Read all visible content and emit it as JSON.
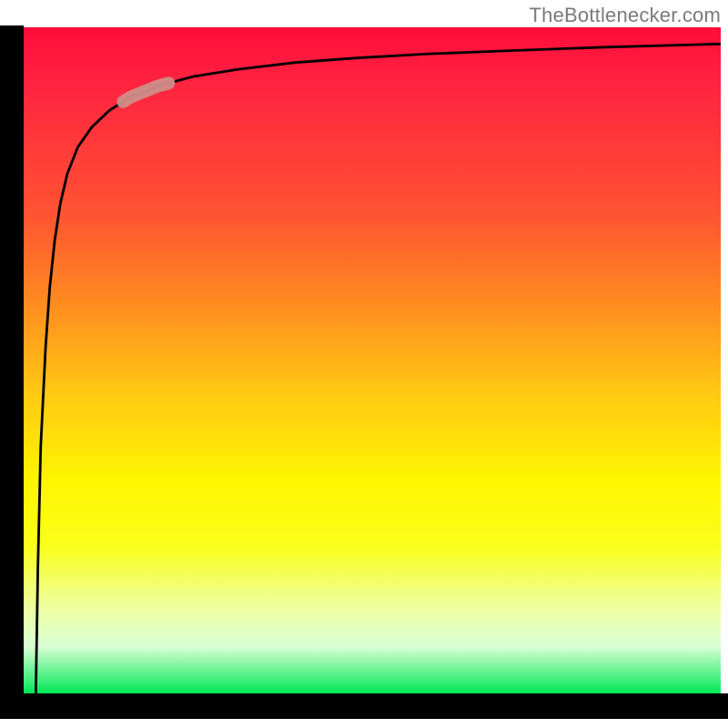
{
  "watermark": "TheBottlenecker.com",
  "chart_data": {
    "type": "line",
    "title": "",
    "xlabel": "",
    "ylabel": "",
    "xlim": [
      0,
      1
    ],
    "ylim": [
      0,
      1
    ],
    "grid": false,
    "background_gradient": [
      "#ff0c3a",
      "#ff8e1f",
      "#fff500",
      "#00e756"
    ],
    "series": [
      {
        "name": "curve",
        "x": [
          0.02,
          0.023,
          0.027,
          0.034,
          0.04,
          0.047,
          0.055,
          0.065,
          0.08,
          0.1,
          0.125,
          0.155,
          0.195,
          0.245,
          0.31,
          0.39,
          0.48,
          0.58,
          0.7,
          0.83,
          1.0
        ],
        "y": [
          0.0,
          0.19,
          0.37,
          0.52,
          0.61,
          0.68,
          0.735,
          0.78,
          0.82,
          0.85,
          0.875,
          0.895,
          0.912,
          0.926,
          0.937,
          0.947,
          0.954,
          0.96,
          0.965,
          0.97,
          0.975
        ]
      }
    ],
    "highlight": {
      "x_range": [
        0.145,
        0.21
      ],
      "note": "pink segment marker on curve"
    }
  }
}
